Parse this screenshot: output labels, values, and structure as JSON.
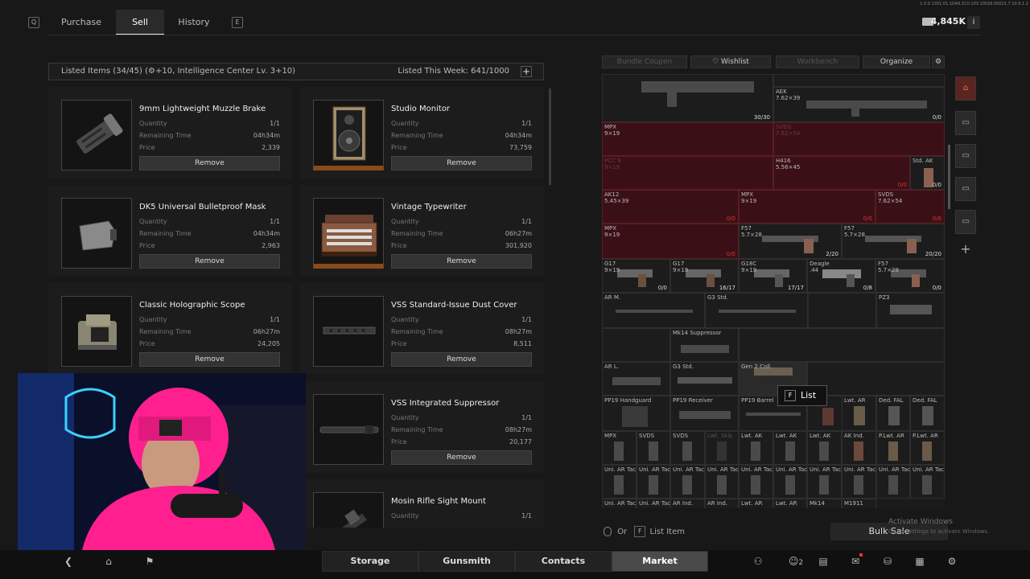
{
  "topbar": {
    "left_key": "Q",
    "right_key": "E",
    "tabs": [
      "Purchase",
      "Sell",
      "History"
    ],
    "money": "4,845K",
    "info": "i",
    "debug": "1.0.0.1351.01.1DA6.1C0.103.10029.50021.7.10.9.1.2"
  },
  "listing": {
    "header_left": "Listed Items (34/45)  (⚙+10, Intelligence Center Lv. 3+10)",
    "header_right": "Listed This Week: 641/1000",
    "add": "+",
    "quantity_label": "Quantity",
    "time_label": "Remaining Time",
    "price_label": "Price",
    "remove_label": "Remove",
    "items": [
      {
        "name": "9mm Lightweight Muzzle Brake",
        "qty": "1/1",
        "time": "04h34m",
        "price": "2,339"
      },
      {
        "name": "Studio Monitor",
        "qty": "1/1",
        "time": "04h34m",
        "price": "73,759"
      },
      {
        "name": "DK5 Universal Bulletproof Mask",
        "qty": "1/1",
        "time": "04h34m",
        "price": "2,963"
      },
      {
        "name": "Vintage Typewriter",
        "qty": "1/1",
        "time": "06h27m",
        "price": "301,920"
      },
      {
        "name": "Classic Holographic Scope",
        "qty": "1/1",
        "time": "06h27m",
        "price": "24,205"
      },
      {
        "name": "VSS Standard-Issue Dust Cover",
        "qty": "1/1",
        "time": "08h27m",
        "price": "8,511"
      },
      {
        "name": "VSS Integrated Suppressor",
        "qty": "1/1",
        "time": "08h27m",
        "price": "20,177"
      },
      {
        "name": "Mosin Rifle Sight Mount",
        "qty": "1/1",
        "time": "",
        "price": ""
      }
    ]
  },
  "stash": {
    "toolbar": [
      "Bundle Coupon",
      "♡ Wishlist",
      "Workbench",
      "Organize"
    ],
    "cells": [
      {
        "label": "",
        "count": "30/30"
      },
      {
        "label": "AEK\n7.62×39",
        "count": "0/0"
      },
      {
        "label": "MPX\n9×19",
        "count": ""
      },
      {
        "label": "SVDS\n7.62×54",
        "count": ""
      },
      {
        "label": "PCC 9\n9×19",
        "count": ""
      },
      {
        "label": "H416\n5.56×45",
        "count": "0/0"
      },
      {
        "label": "Std. AK",
        "count": "0/0"
      },
      {
        "label": "AK12\n5.45×39",
        "count": "0/0"
      },
      {
        "label": "MPX\n9×19",
        "count": "0/0"
      },
      {
        "label": "SVDS\n7.62×54",
        "count": "0/0"
      },
      {
        "label": "MPX\n9×19",
        "count": "0/0"
      },
      {
        "label": "F57\n5.7×28",
        "count": "2/20"
      },
      {
        "label": "F57\n5.7×28",
        "count": "20/20"
      },
      {
        "label": "G17\n9×19",
        "count": "0/0"
      },
      {
        "label": "G17\n9×19",
        "count": "16/17"
      },
      {
        "label": "G18C\n9×19",
        "count": "17/17"
      },
      {
        "label": "Deagle\n.44",
        "count": "0/8"
      },
      {
        "label": "F57\n5.7×28",
        "count": "0/0"
      },
      {
        "label": "AR M.",
        "count": ""
      },
      {
        "label": "G3 Std.",
        "count": ""
      },
      {
        "label": "PZ3",
        "count": ""
      },
      {
        "label": "Mk14 Suppressor",
        "count": ""
      },
      {
        "label": "AR L.",
        "count": ""
      },
      {
        "label": "G3 Std.",
        "count": ""
      },
      {
        "label": "Gen 2 Coll.",
        "count": ""
      },
      {
        "label": "PP19 Handguard",
        "count": ""
      },
      {
        "label": "PP19 Receiver",
        "count": ""
      },
      {
        "label": "PP19 Barrel",
        "count": ""
      },
      {
        "label": "Lwt. AR",
        "count": ""
      },
      {
        "label": "Ded. FAL",
        "count": ""
      },
      {
        "label": "Ded. FAL",
        "count": ""
      },
      {
        "label": "MPX",
        "count": ""
      },
      {
        "label": "SVDS",
        "count": ""
      },
      {
        "label": "SVDS",
        "count": ""
      },
      {
        "label": "Lwt. Skis",
        "count": ""
      },
      {
        "label": "Lwt. AK",
        "count": ""
      },
      {
        "label": "Lwt. AK",
        "count": ""
      },
      {
        "label": "Lwt. AK",
        "count": ""
      },
      {
        "label": "AK Ind.",
        "count": ""
      },
      {
        "label": "P.Lwt. AR",
        "count": ""
      },
      {
        "label": "P.Lwt. AR",
        "count": ""
      },
      {
        "label": "Uni. AR Tac.",
        "count": ""
      },
      {
        "label": "Uni. AR Tac.",
        "count": ""
      },
      {
        "label": "Uni. AR Tac.",
        "count": ""
      },
      {
        "label": "Uni. AR Tac.",
        "count": ""
      },
      {
        "label": "Uni. AR Tac.",
        "count": ""
      },
      {
        "label": "Uni. AR Tac.",
        "count": ""
      },
      {
        "label": "Uni. AR Tac.",
        "count": ""
      },
      {
        "label": "Uni. AR Tac.",
        "count": ""
      },
      {
        "label": "Uni. AR Tac.",
        "count": ""
      },
      {
        "label": "Uni. AR Tac.",
        "count": ""
      },
      {
        "label": "Uni. AR Tac.",
        "count": ""
      },
      {
        "label": "Uni. AR Tac.",
        "count": ""
      },
      {
        "label": "AR Ind.",
        "count": ""
      },
      {
        "label": "AR Ind.",
        "count": ""
      },
      {
        "label": "Lwt. AR",
        "count": ""
      },
      {
        "label": "Lwt. AR",
        "count": ""
      },
      {
        "label": "Mk14",
        "count": ""
      },
      {
        "label": "M1911",
        "count": ""
      }
    ],
    "tooltip_key": "F",
    "tooltip_label": "List",
    "hint_or": "Or",
    "hint_key": "F",
    "hint_label": "List Item",
    "bulk_sale": "Bulk Sale",
    "watermark_title": "Activate Windows",
    "watermark_sub": "Go to Settings to activate Windows.",
    "side_add": "+"
  },
  "nav": {
    "tabs": [
      "Storage",
      "Gunsmith",
      "Contacts",
      "Market"
    ],
    "friends_count": "2"
  }
}
